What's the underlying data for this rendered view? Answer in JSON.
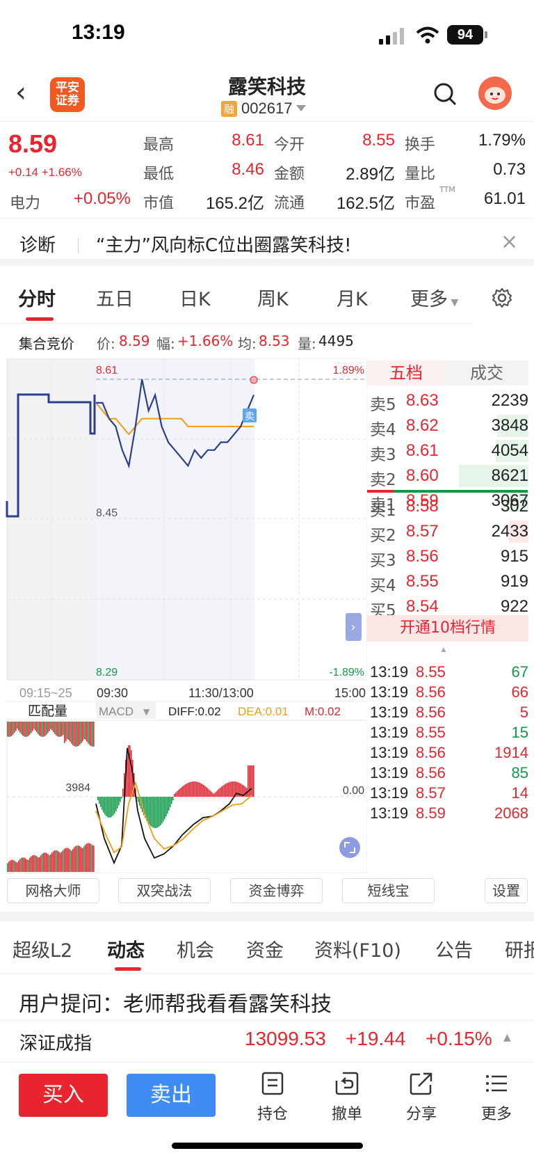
{
  "status": {
    "time": "13:19",
    "battery": "94"
  },
  "header": {
    "logo_line1": "平安",
    "logo_line2": "证券",
    "title": "露笑科技",
    "rong": "融",
    "code": "002617"
  },
  "quote": {
    "price": "8.59",
    "change": "+0.14 +1.66%",
    "dianli_label": "电力",
    "dianli_value": "+0.05%",
    "items": [
      {
        "label": "最高",
        "value": "8.61",
        "color": "#e8252f"
      },
      {
        "label": "今开",
        "value": "8.55",
        "color": "#e8252f"
      },
      {
        "label": "换手",
        "value": "1.79%",
        "color": "#222"
      },
      {
        "label": "最低",
        "value": "8.46",
        "color": "#e8252f"
      },
      {
        "label": "金额",
        "value": "2.89亿",
        "color": "#222"
      },
      {
        "label": "量比",
        "value": "0.73",
        "color": "#222"
      },
      {
        "label": "市值",
        "value": "165.2亿",
        "color": "#222"
      },
      {
        "label": "流通",
        "value": "162.5亿",
        "color": "#222"
      },
      {
        "label": "市盈",
        "value": "61.01",
        "color": "#222"
      }
    ],
    "ttm": "TTM"
  },
  "diagnosis": {
    "label": "诊断",
    "text": "“主力”风向标C位出圈露笑科技!"
  },
  "ktabs": [
    "分时",
    "五日",
    "日K",
    "周K",
    "月K",
    "更多"
  ],
  "inforow": {
    "label": "集合竞价",
    "price_k": "价:",
    "price_v": "8.59",
    "amp_k": "幅:",
    "amp_v": "+1.66%",
    "avg_k": "均:",
    "avg_v": "8.53",
    "vol_k": "量:",
    "vol_v": "4495"
  },
  "chart": {
    "y_top": "8.61",
    "y_mid": "8.45",
    "y_bot": "8.29",
    "pct_top": "1.89%",
    "pct_bot": "-1.89%",
    "sell_marker": "卖",
    "x_labels": [
      "09:15~25",
      "09:30",
      "11:30/13:00",
      "15:00"
    ],
    "match_label": "匹配量",
    "macd_label": "MACD",
    "diff": "DIFF:0.02",
    "dea": "DEA:0.01",
    "m": "M:0.02",
    "left_vol": "3984",
    "zero": "0.00"
  },
  "chart_data": {
    "type": "line",
    "series": [
      {
        "name": "price",
        "values": [
          8.58,
          8.58,
          8.56,
          8.55,
          8.52,
          8.5,
          8.55,
          8.61,
          8.57,
          8.59,
          8.55,
          8.53,
          8.52,
          8.51,
          8.5,
          8.52,
          8.51,
          8.52,
          8.52,
          8.53,
          8.53,
          8.54,
          8.55,
          8.57,
          8.59
        ]
      },
      {
        "name": "avg",
        "values": [
          8.58,
          8.57,
          8.56,
          8.56,
          8.55,
          8.54,
          8.55,
          8.56,
          8.56,
          8.56,
          8.56,
          8.56,
          8.56,
          8.56,
          8.55,
          8.55,
          8.55,
          8.55,
          8.55,
          8.55,
          8.55,
          8.55,
          8.55,
          8.55,
          8.55
        ]
      }
    ],
    "ylim": [
      8.29,
      8.61
    ]
  },
  "book": {
    "tab_five": "五档",
    "tab_trades": "成交",
    "asks": [
      {
        "label": "卖5",
        "price": "8.63",
        "vol": "2239",
        "frac": 0
      },
      {
        "label": "卖4",
        "price": "8.62",
        "vol": "3848",
        "frac": 0.45
      },
      {
        "label": "卖3",
        "price": "8.61",
        "vol": "4054",
        "frac": 0.47
      },
      {
        "label": "卖2",
        "price": "8.60",
        "vol": "8621",
        "frac": 1.0
      },
      {
        "label": "卖1",
        "price": "8.59",
        "vol": "3067",
        "frac": 0.36
      }
    ],
    "bids": [
      {
        "label": "买1",
        "price": "8.58",
        "vol": "302",
        "frac": 0
      },
      {
        "label": "买2",
        "price": "8.57",
        "vol": "2433",
        "frac": 0.28
      },
      {
        "label": "买3",
        "price": "8.56",
        "vol": "915",
        "frac": 0
      },
      {
        "label": "买4",
        "price": "8.55",
        "vol": "919",
        "frac": 0
      },
      {
        "label": "买5",
        "price": "8.54",
        "vol": "922",
        "frac": 0
      }
    ],
    "open_ten": "开通10档行情",
    "trades": [
      {
        "t": "13:19",
        "p": "8.55",
        "v": "67",
        "pc": "#e8252f",
        "vc": "#109a4a"
      },
      {
        "t": "13:19",
        "p": "8.56",
        "v": "66",
        "pc": "#e8252f",
        "vc": "#e8252f"
      },
      {
        "t": "13:19",
        "p": "8.56",
        "v": "5",
        "pc": "#e8252f",
        "vc": "#e8252f"
      },
      {
        "t": "13:19",
        "p": "8.55",
        "v": "15",
        "pc": "#e8252f",
        "vc": "#109a4a"
      },
      {
        "t": "13:19",
        "p": "8.56",
        "v": "1914",
        "pc": "#e8252f",
        "vc": "#e8252f"
      },
      {
        "t": "13:19",
        "p": "8.56",
        "v": "85",
        "pc": "#e8252f",
        "vc": "#109a4a"
      },
      {
        "t": "13:19",
        "p": "8.57",
        "v": "14",
        "pc": "#e8252f",
        "vc": "#e8252f"
      },
      {
        "t": "13:19",
        "p": "8.59",
        "v": "2068",
        "pc": "#e8252f",
        "vc": "#e8252f"
      }
    ]
  },
  "tools": [
    "网格大师",
    "双突战法",
    "资金博弈",
    "短线宝",
    "设置"
  ],
  "itabs": [
    "超级L2",
    "动态",
    "机会",
    "资金",
    "资料(F10)",
    "公告",
    "研报"
  ],
  "question": "用户提问：老师帮我看看露笑科技",
  "index": {
    "name": "深证成指",
    "value": "13099.53",
    "change": "+19.44",
    "pct": "+0.15%"
  },
  "bottom": {
    "buy": "买入",
    "sell": "卖出",
    "hold": "持仓",
    "cancel": "撤单",
    "share": "分享",
    "more": "更多"
  },
  "colors": {
    "up": "#e8252f",
    "down": "#109a4a",
    "price_line": "#2b3f8f",
    "avg_line": "#f39c12"
  }
}
